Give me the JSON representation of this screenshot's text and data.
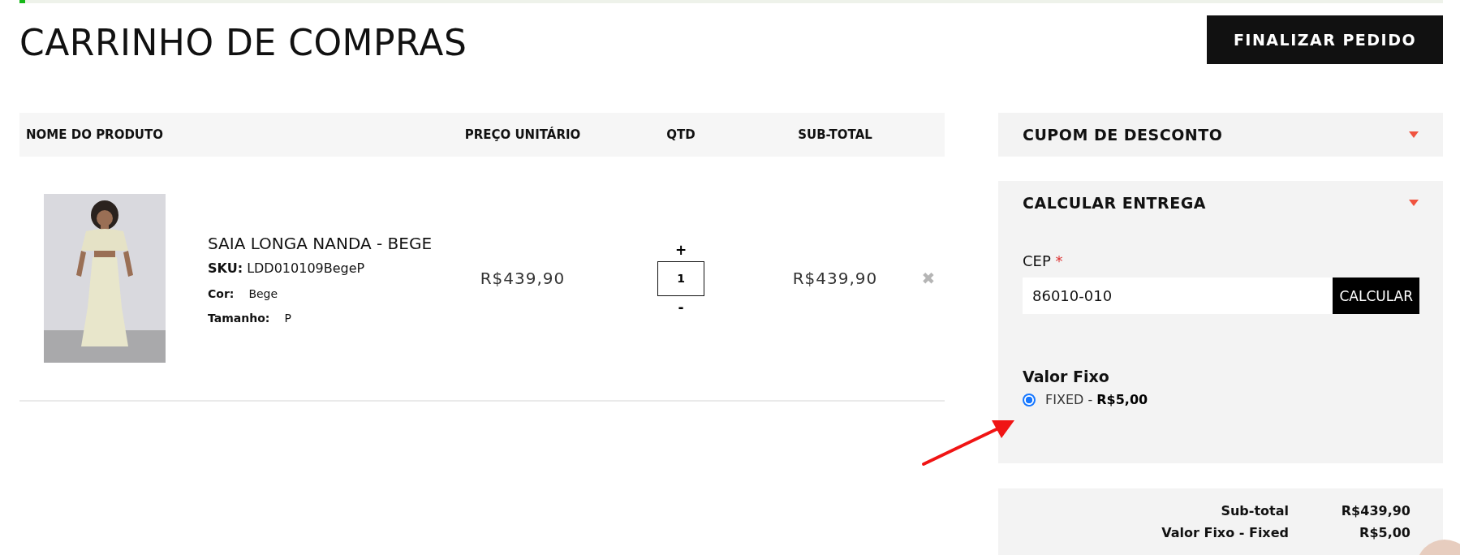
{
  "progress_bar": {
    "level": 0.004
  },
  "page_title": "CARRINHO DE COMPRAS",
  "checkout_button": "FINALIZAR PEDIDO",
  "cart_table": {
    "columns": [
      "NOME DO PRODUTO",
      "PREÇO UNITÁRIO",
      "QTD",
      "SUB-TOTAL"
    ],
    "rows": [
      {
        "name": "SAIA LONGA NANDA - BEGE",
        "sku_label": "SKU:",
        "sku": "LDD010109BegeP",
        "attributes": [
          {
            "label": "Cor:",
            "value": "Bege"
          },
          {
            "label": "Tamanho:",
            "value": "P"
          }
        ],
        "unit_price": "R$439,90",
        "qty_increase": "+",
        "quantity": "1",
        "qty_decrease": "-",
        "subtotal": "R$439,90",
        "remove": "✖"
      }
    ]
  },
  "coupon_panel": {
    "title": "CUPOM DE DESCONTO"
  },
  "shipping_panel": {
    "title": "CALCULAR ENTREGA",
    "cep_label": "CEP",
    "required_mark": "*",
    "cep_value": "86010-010",
    "calculate_button": "CALCULAR",
    "method_title": "Valor Fixo",
    "options": [
      {
        "label": "FIXED - **R$5,00**",
        "selected": true
      }
    ]
  },
  "totals": [
    {
      "label": "Sub-total",
      "value": "R$439,90"
    },
    {
      "label": "Valor Fixo - Fixed",
      "value": "R$5,00"
    }
  ]
}
